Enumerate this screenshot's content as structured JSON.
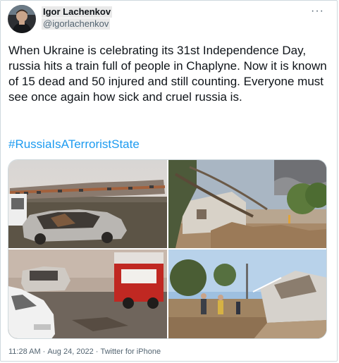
{
  "author": {
    "name": "Igor Lachenkov",
    "handle": "@igorlachenkov"
  },
  "menu": {
    "more_icon": "more-horizontal-icon",
    "more_label": "···"
  },
  "tweet": {
    "text": "When Ukraine is celebrating its 31st Independence Day, russia hits a train full of people in Chaplyne. Now it is known of 15 dead and 50 injured and still counting. Everyone must see once again how sick and cruel russia is.",
    "hashtag": "#RussiaIsATerroristState"
  },
  "media": {
    "photos": [
      {
        "subject": "burned-out car in front of damaged train"
      },
      {
        "subject": "destroyed house with fallen trees"
      },
      {
        "subject": "burned car with fire truck"
      },
      {
        "subject": "ruined house and firefighters"
      }
    ]
  },
  "meta": {
    "time": "11:28 AM",
    "date": "Aug 24, 2022",
    "separator": "·",
    "source": "Twitter for iPhone"
  },
  "colors": {
    "link": "#1d9bf0",
    "secondary_text": "#536471",
    "primary_text": "#0f1419",
    "border": "#cfd9de"
  }
}
